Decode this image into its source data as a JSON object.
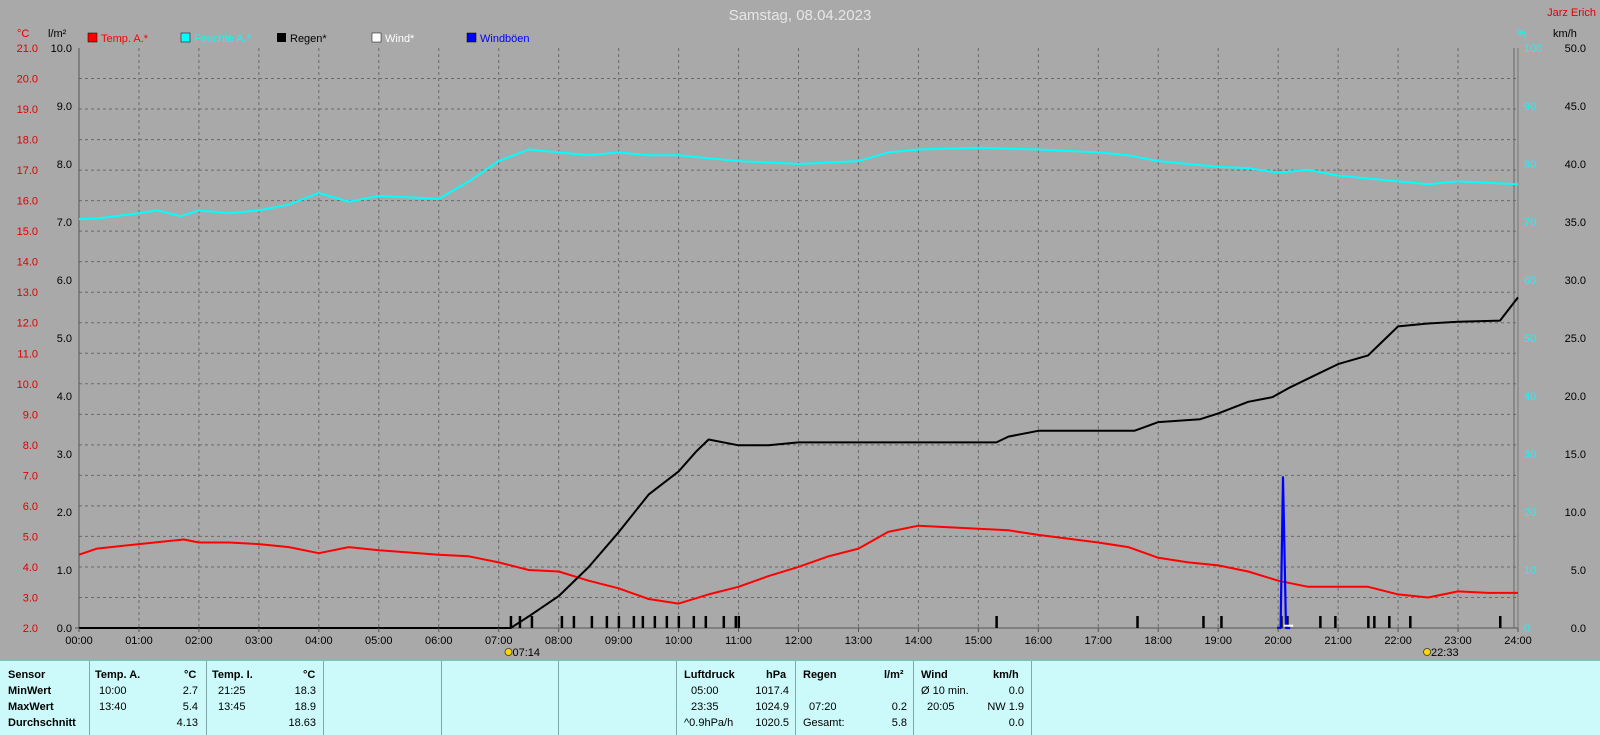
{
  "header": {
    "title": "Samstag, 08.04.2023",
    "author": "Jarz Erich"
  },
  "axes": {
    "temp_unit": "°C",
    "rain_unit": "l/m²",
    "humidity_unit": "%",
    "wind_unit": "km/h",
    "temp_ticks": [
      "2.0",
      "3.0",
      "4.0",
      "5.0",
      "6.0",
      "7.0",
      "8.0",
      "9.0",
      "10.0",
      "11.0",
      "12.0",
      "13.0",
      "14.0",
      "15.0",
      "16.0",
      "17.0",
      "18.0",
      "19.0",
      "20.0",
      "21.0"
    ],
    "rain_ticks": [
      "0.0",
      "1.0",
      "2.0",
      "3.0",
      "4.0",
      "5.0",
      "6.0",
      "7.0",
      "8.0",
      "9.0",
      "10.0"
    ],
    "hum_ticks": [
      "0",
      "10",
      "20",
      "30",
      "40",
      "50",
      "60",
      "70",
      "80",
      "90",
      "100"
    ],
    "wind_ticks": [
      "0.0",
      "5.0",
      "10.0",
      "15.0",
      "20.0",
      "25.0",
      "30.0",
      "35.0",
      "40.0",
      "45.0",
      "50.0"
    ],
    "time_ticks": [
      "00:00",
      "01:00",
      "02:00",
      "03:00",
      "04:00",
      "05:00",
      "06:00",
      "07:00",
      "08:00",
      "09:00",
      "10:00",
      "11:00",
      "12:00",
      "13:00",
      "14:00",
      "15:00",
      "16:00",
      "17:00",
      "18:00",
      "19:00",
      "20:00",
      "21:00",
      "22:00",
      "23:00",
      "24:00"
    ],
    "sunrise": "07:14",
    "sunset": "22:33"
  },
  "legend": [
    {
      "label": "Temp. A.*",
      "color": "#ff0000"
    },
    {
      "label": "Feuchte A.*",
      "color": "#00ffff"
    },
    {
      "label": "Regen*",
      "color": "#000000"
    },
    {
      "label": "Wind*",
      "color": "#ffffff"
    },
    {
      "label": "Windböen",
      "color": "#0000ff"
    }
  ],
  "chart_data": {
    "type": "line",
    "title": "Samstag, 08.04.2023",
    "x_range": [
      0,
      24
    ],
    "grid": true,
    "legend_position": "top-left",
    "series": [
      {
        "name": "Temp. A.*",
        "color": "#ff0000",
        "axis": "temp",
        "ylim": [
          2,
          21
        ],
        "points": [
          [
            0,
            4.4
          ],
          [
            0.3,
            4.6
          ],
          [
            1,
            4.75
          ],
          [
            1.5,
            4.85
          ],
          [
            1.75,
            4.9
          ],
          [
            2,
            4.8
          ],
          [
            2.5,
            4.8
          ],
          [
            3,
            4.75
          ],
          [
            3.5,
            4.65
          ],
          [
            4,
            4.45
          ],
          [
            4.5,
            4.65
          ],
          [
            5,
            4.55
          ],
          [
            6,
            4.4
          ],
          [
            6.5,
            4.35
          ],
          [
            7,
            4.15
          ],
          [
            7.5,
            3.9
          ],
          [
            8,
            3.85
          ],
          [
            8.5,
            3.55
          ],
          [
            9,
            3.3
          ],
          [
            9.5,
            2.95
          ],
          [
            10,
            2.8
          ],
          [
            10.5,
            3.1
          ],
          [
            11,
            3.35
          ],
          [
            11.5,
            3.7
          ],
          [
            12,
            4.0
          ],
          [
            12.5,
            4.35
          ],
          [
            13,
            4.6
          ],
          [
            13.5,
            5.15
          ],
          [
            14,
            5.35
          ],
          [
            14.5,
            5.3
          ],
          [
            15,
            5.25
          ],
          [
            15.5,
            5.2
          ],
          [
            16,
            5.05
          ],
          [
            17,
            4.8
          ],
          [
            17.5,
            4.65
          ],
          [
            18,
            4.3
          ],
          [
            18.5,
            4.15
          ],
          [
            19,
            4.05
          ],
          [
            19.5,
            3.85
          ],
          [
            20,
            3.55
          ],
          [
            20.5,
            3.35
          ],
          [
            21,
            3.35
          ],
          [
            21.5,
            3.35
          ],
          [
            22,
            3.1
          ],
          [
            22.5,
            3.0
          ],
          [
            23,
            3.2
          ],
          [
            23.5,
            3.15
          ],
          [
            24,
            3.15
          ]
        ]
      },
      {
        "name": "Feuchte A.*",
        "color": "#00ffff",
        "axis": "hum",
        "ylim": [
          0,
          100
        ],
        "points": [
          [
            0,
            70.5
          ],
          [
            0.3,
            70.6
          ],
          [
            1,
            71.5
          ],
          [
            1.3,
            72.0
          ],
          [
            1.7,
            71.0
          ],
          [
            2,
            72.0
          ],
          [
            2.5,
            71.5
          ],
          [
            3,
            72.0
          ],
          [
            3.5,
            73.0
          ],
          [
            4,
            75.0
          ],
          [
            4.5,
            73.5
          ],
          [
            5,
            74.5
          ],
          [
            6,
            74.0
          ],
          [
            6.5,
            77.0
          ],
          [
            7,
            80.5
          ],
          [
            7.5,
            82.5
          ],
          [
            8,
            82.0
          ],
          [
            8.5,
            81.5
          ],
          [
            9,
            82.0
          ],
          [
            9.5,
            81.5
          ],
          [
            10,
            81.5
          ],
          [
            10.5,
            81.0
          ],
          [
            11,
            80.5
          ],
          [
            12,
            80.0
          ],
          [
            13,
            80.5
          ],
          [
            13.5,
            82.0
          ],
          [
            14,
            82.5
          ],
          [
            15,
            82.8
          ],
          [
            16,
            82.5
          ],
          [
            17,
            82.0
          ],
          [
            17.5,
            81.5
          ],
          [
            18,
            80.5
          ],
          [
            19,
            79.5
          ],
          [
            19.5,
            79.3
          ],
          [
            20,
            78.5
          ],
          [
            20.5,
            79.0
          ],
          [
            21,
            78.0
          ],
          [
            22,
            77.0
          ],
          [
            22.5,
            76.5
          ],
          [
            23,
            77.0
          ],
          [
            24,
            76.5
          ]
        ]
      },
      {
        "name": "Regen*",
        "color": "#000000",
        "axis": "rain",
        "ylim": [
          0,
          10
        ],
        "points": [
          [
            0,
            0
          ],
          [
            7.2,
            0
          ],
          [
            7.5,
            0.2
          ],
          [
            8,
            0.55
          ],
          [
            8.5,
            1.05
          ],
          [
            9,
            1.65
          ],
          [
            9.5,
            2.3
          ],
          [
            10,
            2.7
          ],
          [
            10.3,
            3.05
          ],
          [
            10.5,
            3.25
          ],
          [
            11,
            3.15
          ],
          [
            11.5,
            3.15
          ],
          [
            12,
            3.2
          ],
          [
            15.3,
            3.2
          ],
          [
            15.5,
            3.3
          ],
          [
            16,
            3.4
          ],
          [
            17.6,
            3.4
          ],
          [
            18,
            3.55
          ],
          [
            18.7,
            3.6
          ],
          [
            19,
            3.7
          ],
          [
            19.5,
            3.9
          ],
          [
            19.9,
            3.98
          ],
          [
            20.2,
            4.15
          ],
          [
            20.6,
            4.35
          ],
          [
            21,
            4.55
          ],
          [
            21.5,
            4.7
          ],
          [
            22,
            5.2
          ],
          [
            22.5,
            5.25
          ],
          [
            23,
            5.28
          ],
          [
            23.7,
            5.3
          ],
          [
            24,
            5.7
          ]
        ]
      },
      {
        "name": "Windböen",
        "color": "#0000ff",
        "axis": "wind",
        "ylim": [
          0,
          50
        ],
        "points": [
          [
            19.98,
            0
          ],
          [
            20.04,
            0
          ],
          [
            20.08,
            13
          ],
          [
            20.13,
            0
          ],
          [
            20.2,
            0
          ]
        ]
      },
      {
        "name": "Wind*",
        "color": "#ffffff",
        "axis": "wind",
        "ylim": [
          0,
          50
        ],
        "points": [
          [
            20.1,
            0.2
          ],
          [
            20.25,
            0.2
          ]
        ]
      }
    ],
    "rain_event_times": [
      7.2,
      7.35,
      7.55,
      8.05,
      8.25,
      8.55,
      8.8,
      9.0,
      9.25,
      9.4,
      9.6,
      9.8,
      10.0,
      10.25,
      10.45,
      10.75,
      10.95,
      11.0,
      15.3,
      17.65,
      18.75,
      19.05,
      20.05,
      20.15,
      20.7,
      20.95,
      21.5,
      21.6,
      21.85,
      22.2,
      23.7
    ],
    "sun_markers": [
      7.23,
      22.55
    ]
  },
  "stats": {
    "sensor": {
      "title": "Sensor",
      "rows": [
        "MinWert",
        "MaxWert",
        "Durchschnitt"
      ]
    },
    "temp_a": {
      "title": "Temp. A.",
      "unit": "°C",
      "min_time": "10:00",
      "min_val": "2.7",
      "max_time": "13:40",
      "max_val": "5.4",
      "avg": "4.13"
    },
    "temp_i": {
      "title": "Temp. I.",
      "unit": "°C",
      "min_time": "21:25",
      "min_val": "18.3",
      "max_time": "13:45",
      "max_val": "18.9",
      "avg": "18.63"
    },
    "pressure": {
      "title": "Luftdruck",
      "unit": "hPa",
      "min_time": "05:00",
      "min_val": "1017.4",
      "max_time": "23:35",
      "max_val": "1024.9",
      "avg_label": "^0.9hPa/h",
      "avg": "1020.5"
    },
    "rain": {
      "title": "Regen",
      "unit": "l/m²",
      "max_time": "07:20",
      "max_val": "0.2",
      "total_label": "Gesamt:",
      "total": "5.8"
    },
    "wind": {
      "title": "Wind",
      "unit": "km/h",
      "min_label": "Ø 10 min.",
      "min_val": "0.0",
      "max_time": "20:05",
      "max_val": "NW 1.9",
      "avg": "0.0"
    }
  }
}
